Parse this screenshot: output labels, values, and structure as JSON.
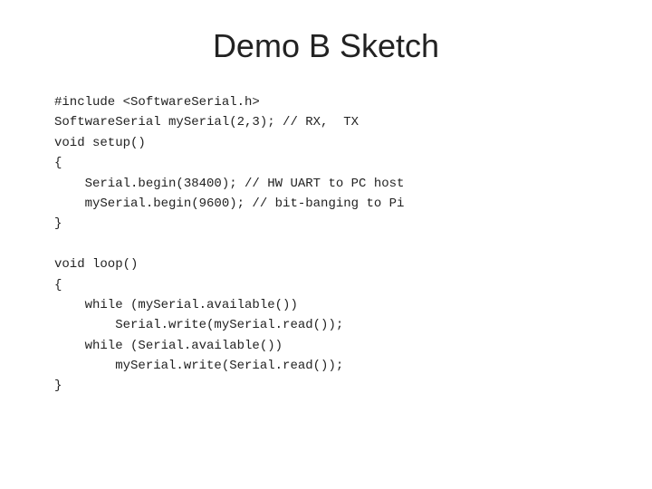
{
  "page": {
    "title": "Demo B Sketch",
    "code": "#include <SoftwareSerial.h>\nSoftwareSerial mySerial(2,3); // RX,  TX\nvoid setup()\n{\n    Serial.begin(38400); // HW UART to PC host\n    mySerial.begin(9600); // bit-banging to Pi\n}\n\nvoid loop()\n{\n    while (mySerial.available())\n        Serial.write(mySerial.read());\n    while (Serial.available())\n        mySerial.write(Serial.read());\n}"
  }
}
